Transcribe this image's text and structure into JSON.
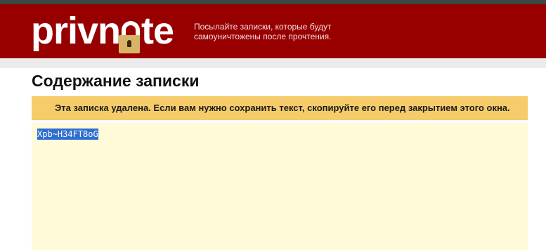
{
  "header": {
    "logo_text_before": "priv",
    "logo_text_after": "te",
    "tagline": "Посылайте записки, которые будут самоуничтожены после прочтения."
  },
  "main": {
    "title": "Содержание записки",
    "notice": "Эта записка удалена. Если вам нужно сохранить текст, скопируйте его перед закрытием этого окна.",
    "note_text": "Xpb~H34FT8oG"
  },
  "colors": {
    "header_bg": "#980000",
    "notice_bg": "#f6cc6a",
    "note_bg": "#fffbd9",
    "selection": "#2f6fd1"
  },
  "icons": {
    "logo_lock": "padlock-icon"
  }
}
